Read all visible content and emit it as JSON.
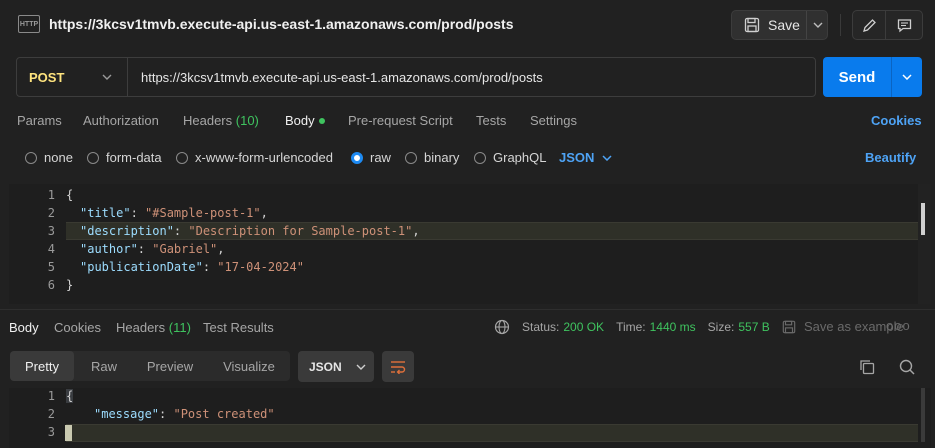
{
  "request": {
    "title": "https://3kcsv1tmvb.execute-api.us-east-1.amazonaws.com/prod/posts",
    "http_icon_text": "HTTP",
    "save_label": "Save",
    "method": "POST",
    "url": "https://3kcsv1tmvb.execute-api.us-east-1.amazonaws.com/prod/posts",
    "send_label": "Send"
  },
  "tabs": {
    "params": "Params",
    "authorization": "Authorization",
    "headers": "Headers",
    "headers_count": "(10)",
    "body": "Body",
    "prerequest": "Pre-request Script",
    "tests": "Tests",
    "settings": "Settings",
    "cookies": "Cookies"
  },
  "body_types": {
    "none": "none",
    "form_data": "form-data",
    "urlencoded": "x-www-form-urlencoded",
    "raw": "raw",
    "binary": "binary",
    "graphql": "GraphQL",
    "language": "JSON",
    "beautify": "Beautify"
  },
  "request_body": {
    "line_numbers": [
      "1",
      "2",
      "3",
      "4",
      "5",
      "6"
    ],
    "open": "{",
    "close": "}",
    "fields": [
      {
        "key": "\"title\"",
        "value": "\"#Sample-post-1\""
      },
      {
        "key": "\"description\"",
        "value": "\"Description for Sample-post-1\""
      },
      {
        "key": "\"author\"",
        "value": "\"Gabriel\""
      },
      {
        "key": "\"publicationDate\"",
        "value": "\"17-04-2024\""
      }
    ]
  },
  "response": {
    "tabs": {
      "body": "Body",
      "cookies": "Cookies",
      "headers": "Headers",
      "headers_count": "(11)",
      "test_results": "Test Results"
    },
    "status_label": "Status:",
    "status_value": "200 OK",
    "time_label": "Time:",
    "time_value": "1440 ms",
    "size_label": "Size:",
    "size_value": "557 B",
    "save_example": "Save as example",
    "more": "ooo",
    "views": {
      "pretty": "Pretty",
      "raw": "Raw",
      "preview": "Preview",
      "visualize": "Visualize"
    },
    "language": "JSON",
    "line_numbers": [
      "1",
      "2",
      "3"
    ],
    "open": "{",
    "close": "}",
    "message_key": "\"message\"",
    "message_value": "\"Post created\""
  },
  "colors": {
    "accent": "#097bed",
    "method": "#ffe47e",
    "success": "#3fc35f",
    "link": "#4ea3f5"
  }
}
